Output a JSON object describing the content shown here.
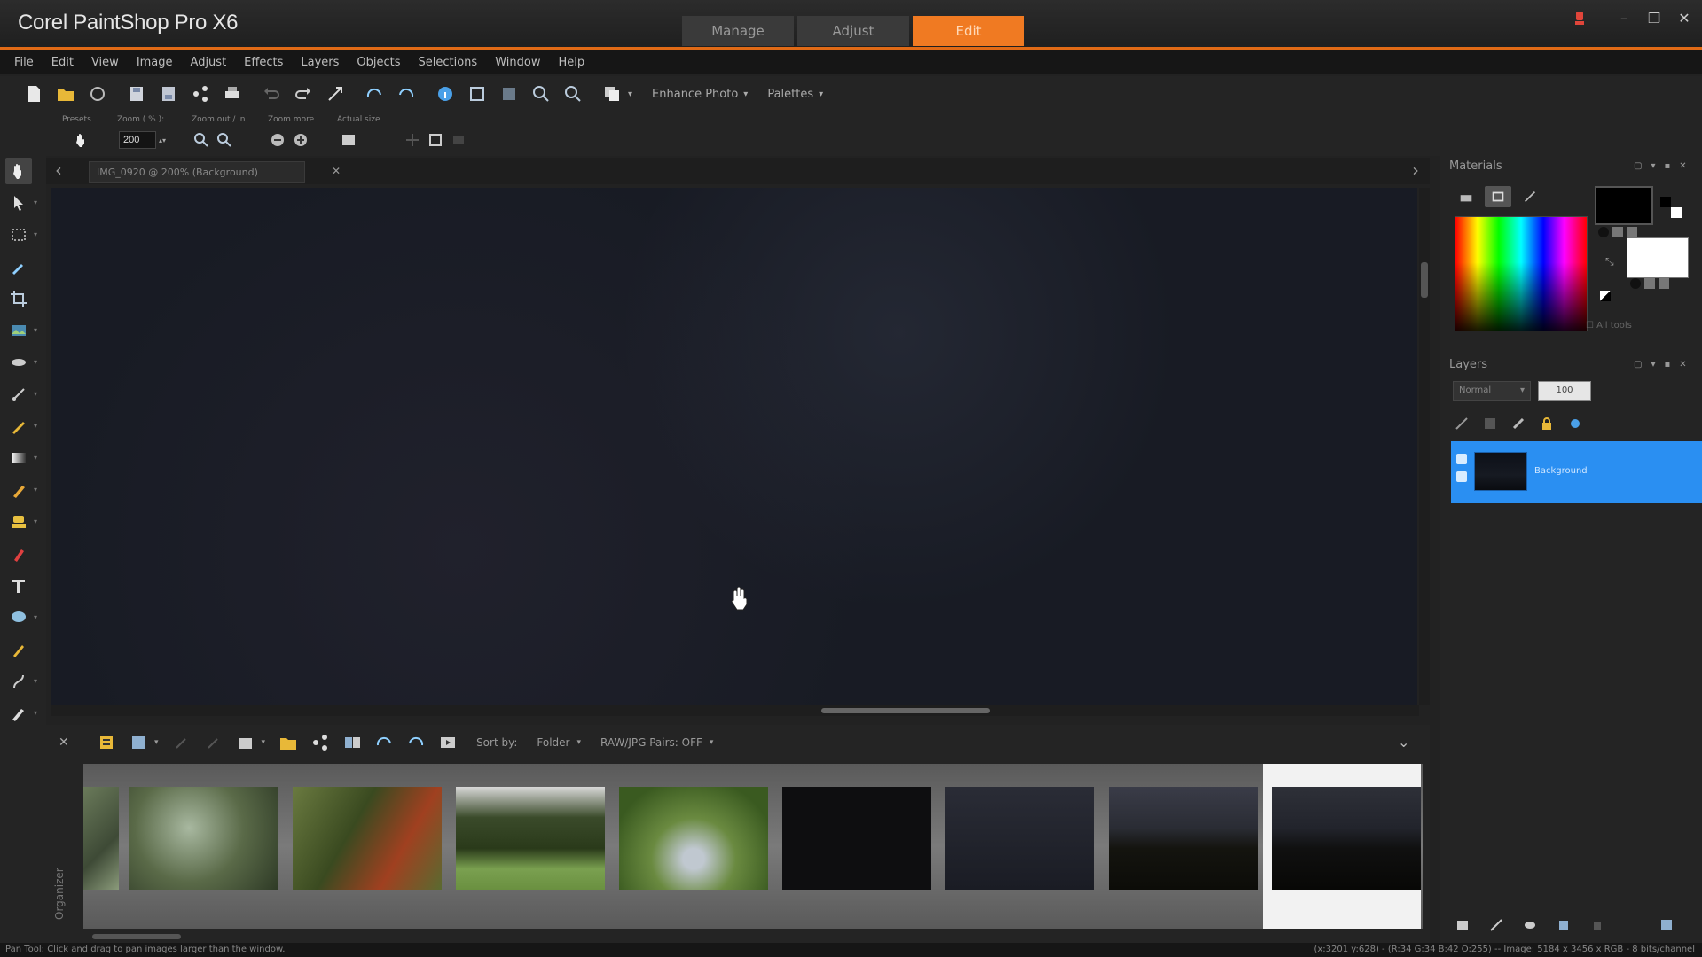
{
  "app": {
    "title": "Corel PaintShop Pro X6",
    "mode_tabs": [
      {
        "label": "Manage",
        "active": false
      },
      {
        "label": "Adjust",
        "active": false
      },
      {
        "label": "Edit",
        "active": true
      }
    ],
    "accent_color": "#f07a22"
  },
  "menu": [
    "File",
    "Edit",
    "View",
    "Image",
    "Adjust",
    "Effects",
    "Layers",
    "Objects",
    "Selections",
    "Window",
    "Help"
  ],
  "toolbar": {
    "enhance_photo_label": "Enhance Photo",
    "palettes_label": "Palettes"
  },
  "tool_options": {
    "presets_label": "Presets",
    "zoom_label": "Zoom ( % ):",
    "zoom_value": "200",
    "zoom_out_in_label": "Zoom out / in",
    "zoom_more_label": "Zoom more",
    "actual_size_label": "Actual size"
  },
  "document": {
    "tab_title": "IMG_0920 @ 200% (Background)"
  },
  "organizer": {
    "side_label": "Organizer",
    "sort_by_label": "Sort by:",
    "sort_value": "Folder",
    "raw_jpg_label": "RAW/JPG Pairs: OFF"
  },
  "materials": {
    "title": "Materials",
    "all_tools_label": "All tools",
    "foreground_color": "#000000",
    "background_color": "#ffffff"
  },
  "layers": {
    "title": "Layers",
    "blend_mode": "Normal",
    "opacity": "100",
    "items": [
      {
        "name": "Background",
        "selected": true
      }
    ]
  },
  "status": {
    "left": "Pan Tool: Click and drag to pan images larger than the window.",
    "right": "(x:3201 y:628) - (R:34 G:34 B:42 O:255) -- Image: 5184 x 3456 x RGB - 8 bits/channel"
  }
}
